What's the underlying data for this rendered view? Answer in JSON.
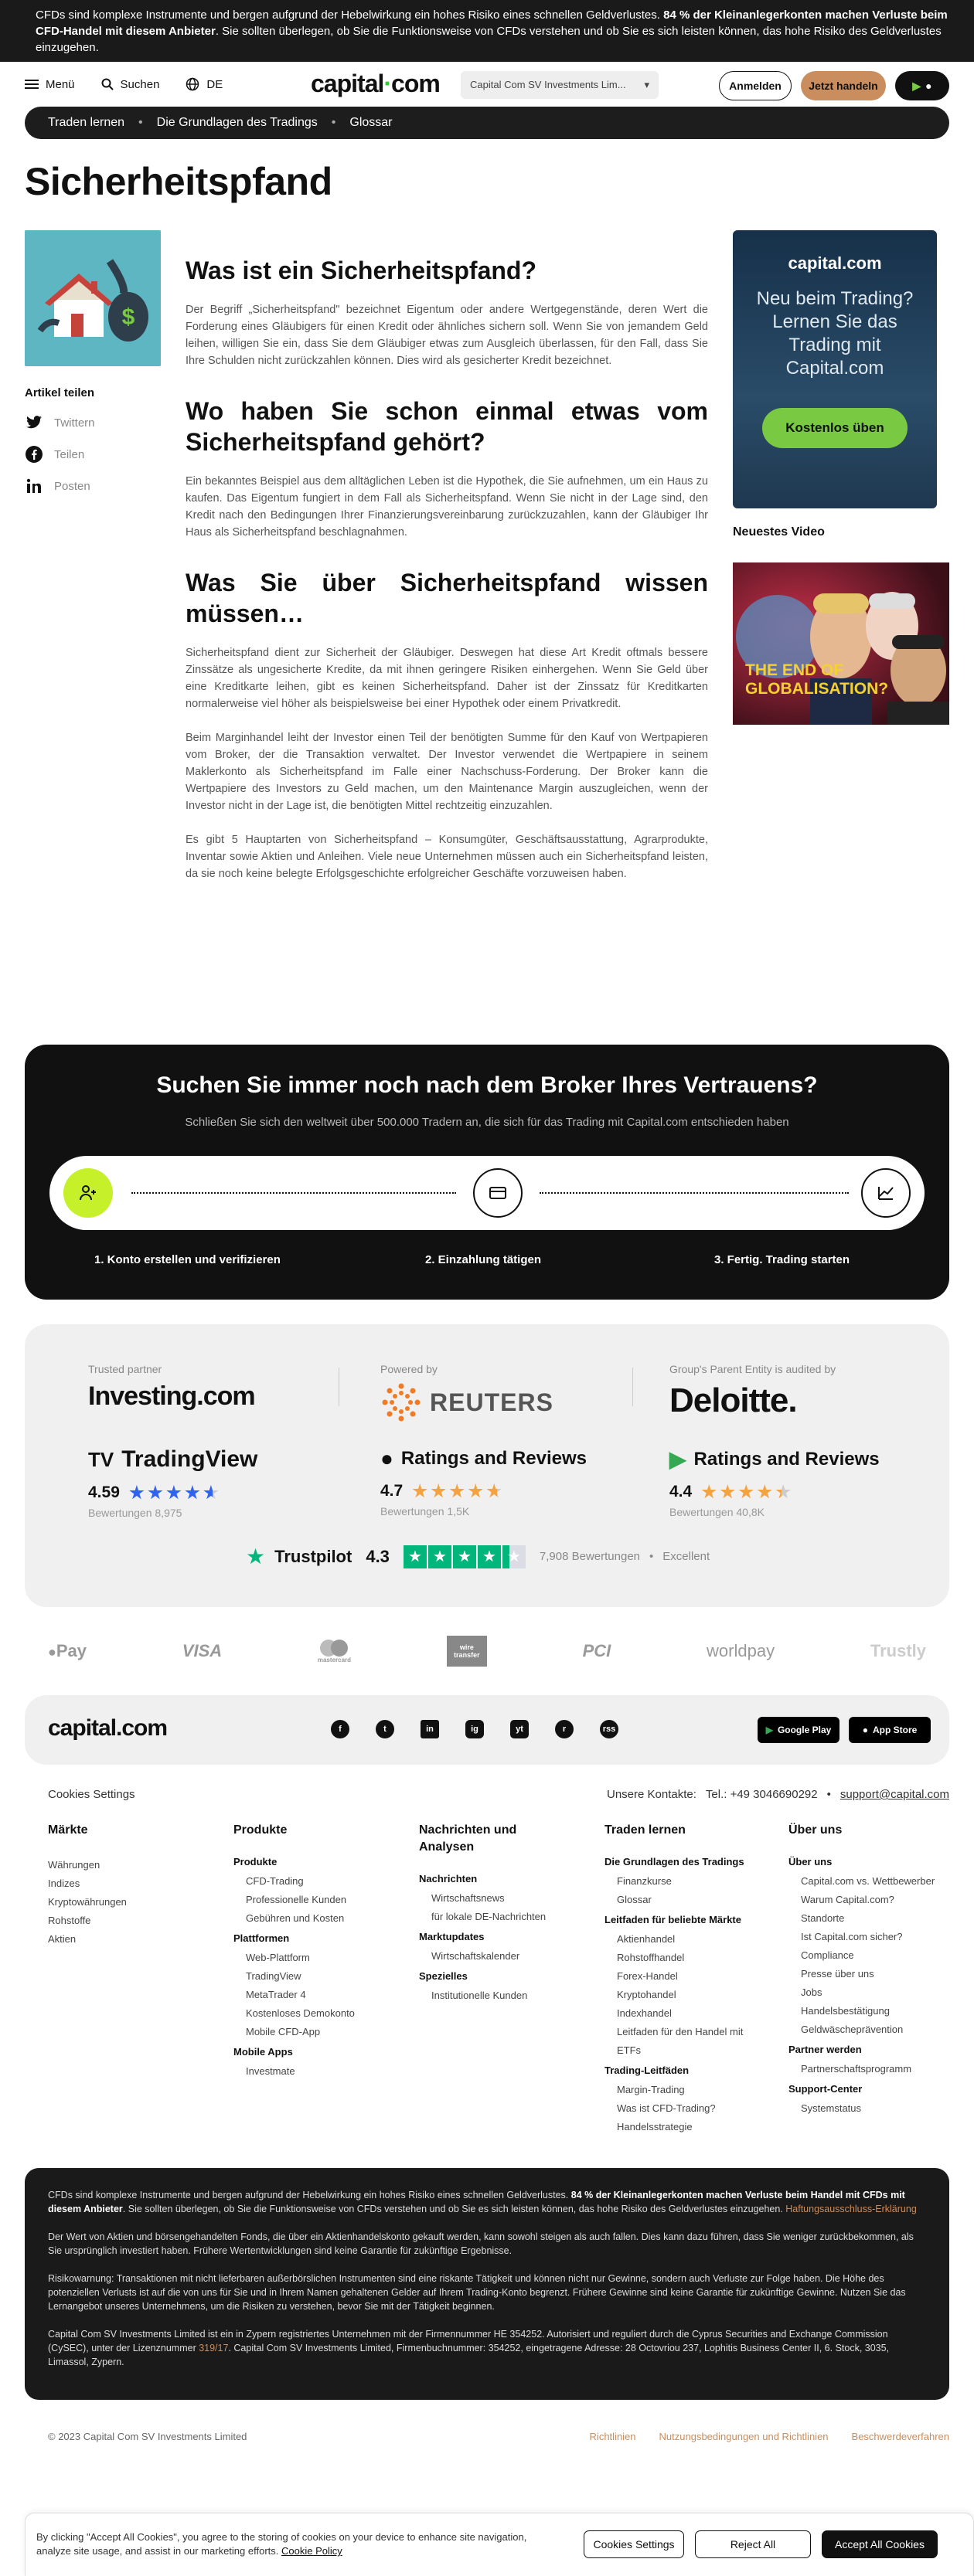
{
  "risk_banner": {
    "part1": "CFDs sind komplexe Instrumente und bergen aufgrund der Hebelwirkung ein hohes Risiko eines schnellen Geldverlustes. ",
    "bold": "84 % der Kleinanlegerkonten machen Verluste beim CFD-Handel mit diesem Anbieter",
    "part2": ". Sie sollten überlegen, ob Sie die Funktionsweise von CFDs verstehen und ob Sie es sich leisten können, das hohe Risiko des Geldverlustes einzugehen."
  },
  "header": {
    "menu": "Menü",
    "search": "Suchen",
    "lang": "DE",
    "logo": "capital",
    "logo_suffix": "com",
    "entity": "Capital Com SV Investments Lim...",
    "login": "Anmelden",
    "trade": "Jetzt handeln"
  },
  "breadcrumb": [
    "Traden lernen",
    "Die Grundlagen des Tradings",
    "Glossar"
  ],
  "page_title": "Sicherheitspfand",
  "share": {
    "title": "Artikel teilen",
    "items": [
      "Twittern",
      "Teilen",
      "Posten"
    ]
  },
  "article": {
    "h1": "Was ist ein Sicherheitspfand?",
    "p1": "Der Begriff „Sicherheitspfand\" bezeichnet Eigentum oder andere Wertgegenstände, deren Wert die Forderung eines Gläubigers für einen Kredit oder ähnliches sichern soll. Wenn Sie von jemandem Geld leihen, willigen Sie ein, dass Sie dem Gläubiger etwas zum Ausgleich überlassen, für den Fall, dass Sie Ihre Schulden nicht zurückzahlen können. Dies wird als gesicherter Kredit bezeichnet.",
    "h2": "Wo haben Sie schon einmal etwas vom Sicherheitspfand gehört?",
    "p2": "Ein bekanntes Beispiel aus dem alltäglichen Leben ist die Hypothek, die Sie aufnehmen, um ein Haus zu kaufen. Das Eigentum fungiert in dem Fall als Sicherheitspfand. Wenn Sie nicht in der Lage sind, den Kredit nach den Bedingungen Ihrer Finanzierungsvereinbarung zurückzuzahlen, kann der Gläubiger Ihr Haus als Sicherheitspfand beschlagnahmen.",
    "h3": "Was Sie über Sicherheitspfand wissen müssen…",
    "p3": "Sicherheitspfand dient zur Sicherheit der Gläubiger. Deswegen hat diese Art Kredit oftmals bessere Zinssätze als ungesicherte Kredite, da mit ihnen geringere Risiken einhergehen. Wenn Sie Geld über eine Kreditkarte leihen, gibt es keinen Sicherheitspfand. Daher ist der Zinssatz für Kreditkarten normalerweise viel höher als beispielsweise bei einer Hypothek oder einem Privatkredit.",
    "p4": "Beim Marginhandel leiht der Investor einen Teil der benötigten Summe für den Kauf von Wertpapieren vom Broker, der die Transaktion verwaltet. Der Investor verwendet die Wertpapiere in seinem Maklerkonto als Sicherheitspfand im Falle einer Nachschuss-Forderung. Der Broker kann die Wertpapiere des Investors zu Geld machen, um den Maintenance Margin auszugleichen, wenn der Investor nicht in der Lage ist, die benötigten Mittel rechtzeitig einzuzahlen.",
    "p5": "Es gibt 5 Hauptarten von Sicherheitspfand – Konsumgüter, Geschäftsausstattung, Agrarprodukte, Inventar sowie Aktien und Anleihen. Viele neue Unternehmen müssen auch ein Sicherheitspfand leisten, da sie noch keine belegte Erfolgsgeschichte erfolgreicher Geschäfte vorzuweisen haben."
  },
  "promo": {
    "logo": "capital.com",
    "text": "Neu beim Trading? Lernen Sie das Trading mit Capital.com",
    "button": "Kostenlos üben"
  },
  "video": {
    "label": "Neuestes Video",
    "caption1": "THE END OF",
    "caption2": "GLOBALISATION?"
  },
  "broker": {
    "title": "Suchen Sie immer noch nach dem Broker Ihres Vertrauens?",
    "subtitle": "Schließen Sie sich den weltweit über 500.000 Tradern an, die sich für das Trading mit Capital.com entschieden haben",
    "steps": [
      "1. Konto erstellen und verifizieren",
      "2. Einzahlung tätigen",
      "3. Fertig. Trading starten"
    ]
  },
  "partners": {
    "trusted_cap": "Trusted partner",
    "trusted_brand": "Investing.com",
    "powered_cap": "Powered by",
    "powered_brand": "REUTERS",
    "audit_cap": "Group's Parent Entity is audited by",
    "audit_brand": "Deloitte.",
    "ratings": [
      {
        "name": "TradingView",
        "value": "4.59",
        "count": "Bewertungen 8,975",
        "stars": 4.59
      },
      {
        "name": "Ratings and Reviews",
        "value": "4.7",
        "count": "Bewertungen 1,5K",
        "stars": 4.7
      },
      {
        "name": "Ratings and Reviews",
        "value": "4.4",
        "count": "Bewertungen 40,8K",
        "stars": 4.4
      }
    ],
    "trustpilot": {
      "label": "Trustpilot",
      "score": "4.3",
      "reviews": "7,908 Bewertungen",
      "rating": "Excellent",
      "stars": 4.3
    }
  },
  "payments": [
    "Pay",
    "VISA",
    "mastercard",
    "wire transfer",
    "PCI",
    "worldpay",
    "Trustly"
  ],
  "footer": {
    "logo": "capital.com",
    "social": [
      "f",
      "t",
      "in",
      "ig",
      "yt",
      "r",
      "rss"
    ],
    "google_play": "Google Play",
    "app_store": "App Store",
    "cookie_settings": "Cookies Settings",
    "contact_label": "Unsere Kontakte:",
    "phone": "Tel.: +49 3046690292",
    "email": "support@capital.com",
    "cols": {
      "maerkte": {
        "title": "Märkte",
        "items": [
          "Währungen",
          "Indizes",
          "Kryptowährungen",
          "Rohstoffe",
          "Aktien"
        ]
      },
      "produkte": {
        "title": "Produkte",
        "g1": "Produkte",
        "g1_items": [
          "CFD-Trading",
          "Professionelle Kunden",
          "Gebühren und Kosten"
        ],
        "g2": "Plattformen",
        "g2_items": [
          "Web-Plattform",
          "TradingView",
          "MetaTrader 4",
          "Kostenloses Demokonto",
          "Mobile CFD-App"
        ],
        "g3": "Mobile Apps",
        "g3_items": [
          "Investmate"
        ]
      },
      "news": {
        "title": "Nachrichten und Analysen",
        "g1": "Nachrichten",
        "g1_items": [
          "Wirtschaftsnews",
          "für lokale DE-Nachrichten"
        ],
        "g2": "Marktupdates",
        "g2_items": [
          "Wirtschaftskalender"
        ],
        "g3": "Spezielles",
        "g3_items": [
          "Institutionelle Kunden"
        ]
      },
      "lernen": {
        "title": "Traden lernen",
        "g1": "Die Grundlagen des Tradings",
        "g1_items": [
          "Finanzkurse",
          "Glossar"
        ],
        "g2": "Leitfaden für beliebte Märkte",
        "g2_items": [
          "Aktienhandel",
          "Rohstoffhandel",
          "Forex-Handel",
          "Kryptohandel",
          "Indexhandel",
          "Leitfaden für den Handel mit ETFs"
        ],
        "g3": "Trading-Leitfäden",
        "g3_items": [
          "Margin-Trading",
          "Was ist CFD-Trading?",
          "Handelsstrategie"
        ]
      },
      "ueber": {
        "title": "Über uns",
        "g1": "Über uns",
        "g1_items": [
          "Capital.com vs. Wettbewerber",
          "Warum Capital.com?",
          "Standorte",
          "Ist Capital.com sicher?",
          "Compliance",
          "Presse über uns",
          "Jobs",
          "Handelsbestätigung",
          "Geldwäscheprävention"
        ],
        "g2": "Partner werden",
        "g2_items": [
          "Partnerschaftsprogramm"
        ],
        "g3": "Support-Center",
        "g3_items": [
          "Systemstatus"
        ]
      }
    },
    "disclaimer": {
      "p1a": "CFDs sind komplexe Instrumente und bergen aufgrund der Hebelwirkung ein hohes Risiko eines schnellen Geldverlustes. ",
      "p1b": "84 % der Kleinanlegerkonten machen Verluste beim Handel mit CFDs mit diesem Anbieter",
      "p1c": ". Sie sollten überlegen, ob Sie die Funktionsweise von CFDs verstehen und ob Sie es sich leisten können, das hohe Risiko des Geldverlustes einzugehen. ",
      "p1link": "Haftungsausschluss-Erklärung",
      "p2": "Der Wert von Aktien und börsengehandelten Fonds, die über ein Aktienhandelskonto gekauft werden, kann sowohl steigen als auch fallen. Dies kann dazu führen, dass Sie weniger zurückbekommen, als Sie ursprünglich investiert haben. Frühere Wertentwicklungen sind keine Garantie für zukünftige Ergebnisse.",
      "p3": "Risikowarnung: Transaktionen mit nicht lieferbaren außerbörslichen Instrumenten sind eine riskante Tätigkeit und können nicht nur Gewinne, sondern auch Verluste zur Folge haben. Die Höhe des potenziellen Verlusts ist auf die von uns für Sie und in Ihrem Namen gehaltenen Gelder auf Ihrem Trading-Konto begrenzt. Frühere Gewinne sind keine Garantie für zukünftige Gewinne. Nutzen Sie das Lernangebot unseres Unternehmens, um die Risiken zu verstehen, bevor Sie mit der Tätigkeit beginnen.",
      "p4a": "Capital Com SV Investments Limited ist ein in Zypern registriertes Unternehmen mit der Firmennummer HE 354252. Autorisiert und reguliert durch die Cyprus Securities and Exchange Commission (CySEC), unter der Lizenznummer ",
      "p4link": "319/17",
      "p4b": ". Capital Com SV Investments Limited, Firmenbuchnummer: 354252, eingetragene Adresse: 28 Octovriou 237, Lophitis Business Center II, 6. Stock, 3035, Limassol, Zypern."
    },
    "copyright": "© 2023 Capital Com SV Investments Limited",
    "links": [
      "Richtlinien",
      "Nutzungsbedingungen und Richtlinien",
      "Beschwerdeverfahren"
    ]
  },
  "cookie_banner": {
    "text": "By clicking \"Accept All Cookies\", you agree to the storing of cookies on your device to enhance site navigation, analyze site usage, and assist in our marketing efforts. ",
    "policy": "Cookie Policy",
    "settings": "Cookies Settings",
    "reject": "Reject All",
    "accept": "Accept All Cookies"
  },
  "colors": {
    "accent_green": "#7ac943",
    "gold": "#c98d5e",
    "dark": "#111111",
    "step_lime": "#c5f02a"
  }
}
